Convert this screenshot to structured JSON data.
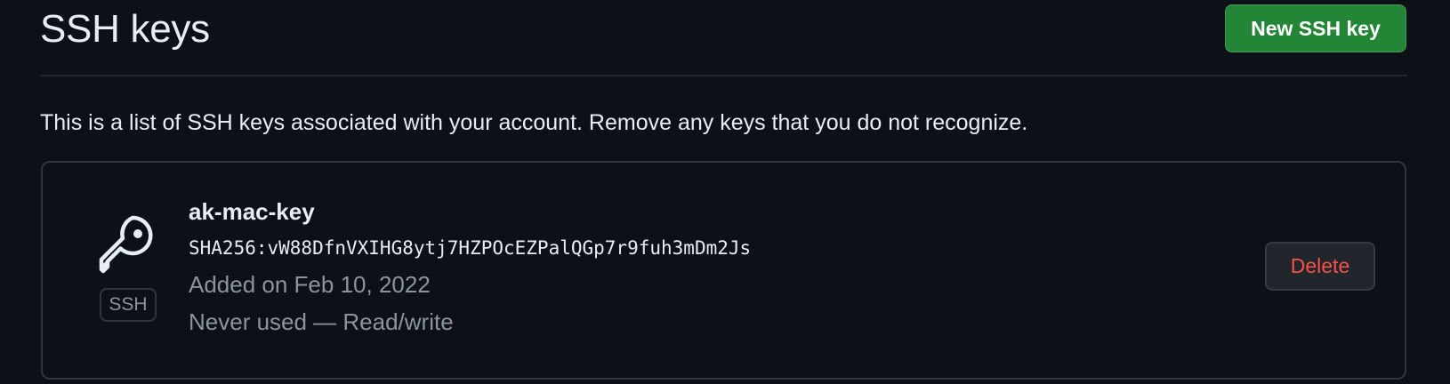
{
  "header": {
    "title": "SSH keys",
    "new_key_label": "New SSH key"
  },
  "intro_text": "This is a list of SSH keys associated with your account. Remove any keys that you do not recognize.",
  "keys": [
    {
      "name": "ak-mac-key",
      "fingerprint": "SHA256:vW88DfnVXIHG8ytj7HZPOcEZPalQGp7r9fuh3mDm2Js",
      "added": "Added on Feb 10, 2022",
      "usage": "Never used — Read/write",
      "type_badge": "SSH",
      "icon": "key-icon",
      "delete_label": "Delete"
    }
  ],
  "colors": {
    "background": "#0d1117",
    "primary_button": "#238636",
    "danger_text": "#f85149",
    "muted_text": "#8b949e",
    "border": "#30363d"
  }
}
